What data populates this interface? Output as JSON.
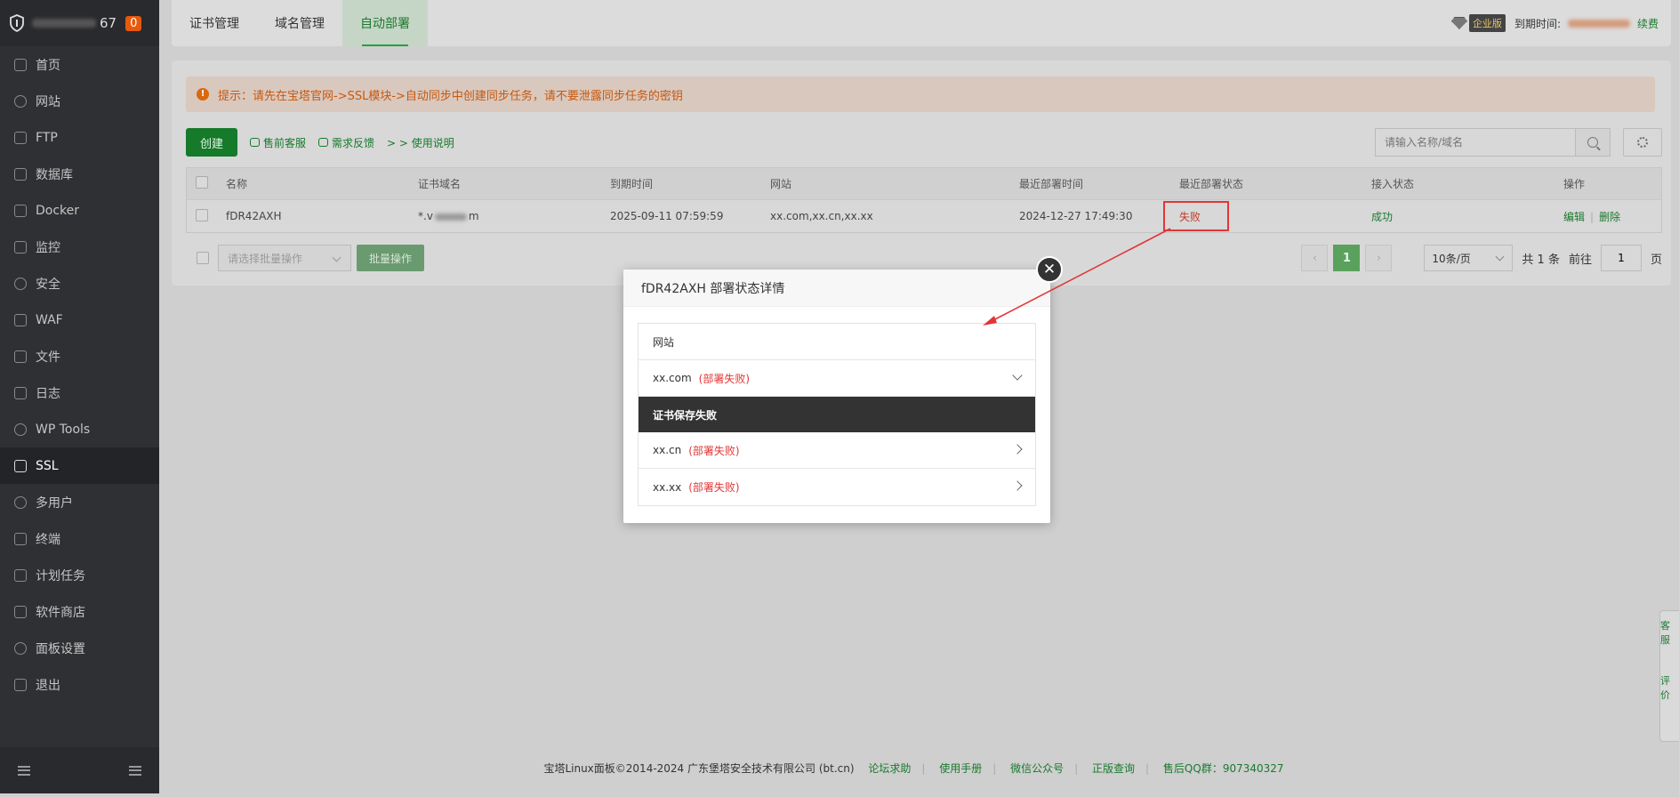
{
  "sidebar": {
    "ip_suffix": "67",
    "notification_count": "0",
    "items": [
      {
        "label": "首页"
      },
      {
        "label": "网站"
      },
      {
        "label": "FTP"
      },
      {
        "label": "数据库"
      },
      {
        "label": "Docker"
      },
      {
        "label": "监控"
      },
      {
        "label": "安全"
      },
      {
        "label": "WAF"
      },
      {
        "label": "文件"
      },
      {
        "label": "日志"
      },
      {
        "label": "WP Tools"
      },
      {
        "label": "SSL"
      },
      {
        "label": "多用户"
      },
      {
        "label": "终端"
      },
      {
        "label": "计划任务"
      },
      {
        "label": "软件商店"
      },
      {
        "label": "面板设置"
      },
      {
        "label": "退出"
      }
    ],
    "active_item": "SSL"
  },
  "header": {
    "tabs": [
      {
        "label": "证书管理"
      },
      {
        "label": "域名管理"
      },
      {
        "label": "自动部署"
      }
    ],
    "active_tab": "自动部署",
    "edition_badge": "企业版",
    "expire_label": "到期时间:",
    "renew_label": "续费"
  },
  "notice": {
    "text": "提示：请先在宝塔官网->SSL模块->自动同步中创建同步任务，请不要泄露同步任务的密钥"
  },
  "toolbar": {
    "create_label": "创建",
    "presale_label": "售前客服",
    "feedback_label": "需求反馈",
    "docs_label": "> > 使用说明",
    "search_placeholder": "请输入名称/域名"
  },
  "table": {
    "columns": [
      "名称",
      "证书域名",
      "到期时间",
      "网站",
      "最近部署时间",
      "最近部署状态",
      "接入状态",
      "操作"
    ],
    "rows": [
      {
        "name": "fDR42AXH",
        "cert_domain_prefix": "*.v",
        "cert_domain_suffix": "m",
        "expire": "2025-09-11 07:59:59",
        "sites": "xx.com,xx.cn,xx.xx",
        "last_deploy_time": "2024-12-27 17:49:30",
        "last_deploy_status": "失败",
        "access_status": "成功",
        "edit_label": "编辑",
        "delete_label": "删除"
      }
    ]
  },
  "batch": {
    "select_placeholder": "请选择批量操作",
    "button_label": "批量操作"
  },
  "pagination": {
    "current_page": "1",
    "page_size": "10条/页",
    "total": "共 1 条",
    "goto_label": "前往",
    "goto_value": "1",
    "page_unit": "页"
  },
  "modal": {
    "title": "fDR42AXH 部署状态详情",
    "section_header": "网站",
    "close_symbol": "✕",
    "sites": [
      {
        "domain": "xx.com",
        "status": "(部署失败)",
        "expanded": true,
        "detail": "证书保存失败"
      },
      {
        "domain": "xx.cn",
        "status": "(部署失败)",
        "expanded": false
      },
      {
        "domain": "xx.xx",
        "status": "(部署失败)",
        "expanded": false
      }
    ]
  },
  "footer": {
    "copyright": "宝塔Linux面板©2014-2024 广东堡塔安全技术有限公司 (bt.cn)",
    "links": [
      "论坛求助",
      "使用手册",
      "微信公众号",
      "正版查询"
    ],
    "qq_group": "售后QQ群：907340327"
  },
  "side_float": {
    "items": [
      "客服",
      "评价"
    ]
  },
  "colors": {
    "accent_green": "#20a53a",
    "error_red": "#e23636",
    "warning_orange": "#c8580e",
    "sidebar_bg": "#2f3033"
  }
}
